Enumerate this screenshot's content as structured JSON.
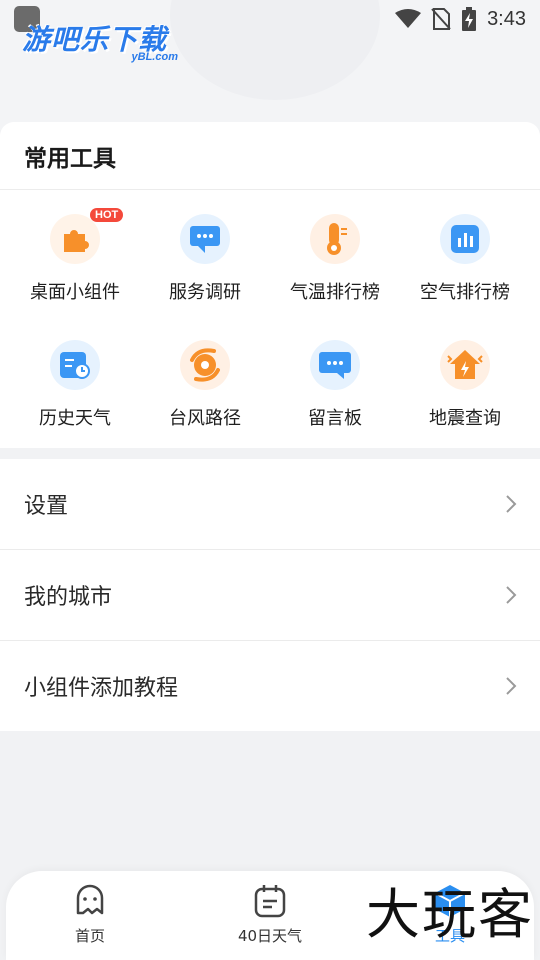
{
  "status_bar": {
    "time": "3:43"
  },
  "logo": {
    "main": "游吧乐下载",
    "sub": "yBL.com"
  },
  "tools": {
    "title": "常用工具",
    "items": [
      {
        "label": "桌面小组件",
        "icon": "puzzle-icon",
        "badge": "HOT"
      },
      {
        "label": "服务调研",
        "icon": "chat-bubble-icon"
      },
      {
        "label": "气温排行榜",
        "icon": "thermometer-icon"
      },
      {
        "label": "空气排行榜",
        "icon": "bar-chart-icon"
      },
      {
        "label": "历史天气",
        "icon": "history-clock-icon"
      },
      {
        "label": "台风路径",
        "icon": "typhoon-icon"
      },
      {
        "label": "留言板",
        "icon": "message-board-icon"
      },
      {
        "label": "地震查询",
        "icon": "earthquake-house-icon"
      }
    ]
  },
  "menu": {
    "items": [
      {
        "label": "设置"
      },
      {
        "label": "我的城市"
      },
      {
        "label": "小组件添加教程"
      }
    ]
  },
  "bottom_nav": {
    "items": [
      {
        "label": "首页",
        "icon": "home-face-icon"
      },
      {
        "label": "40日天气",
        "icon": "calendar-icon"
      },
      {
        "label": "工具",
        "icon": "tools-box-icon",
        "active": true
      }
    ]
  },
  "watermark": "大玩客",
  "colors": {
    "accent": "#2a8ef0",
    "orange": "#f7902a",
    "hot": "#f4493b"
  }
}
